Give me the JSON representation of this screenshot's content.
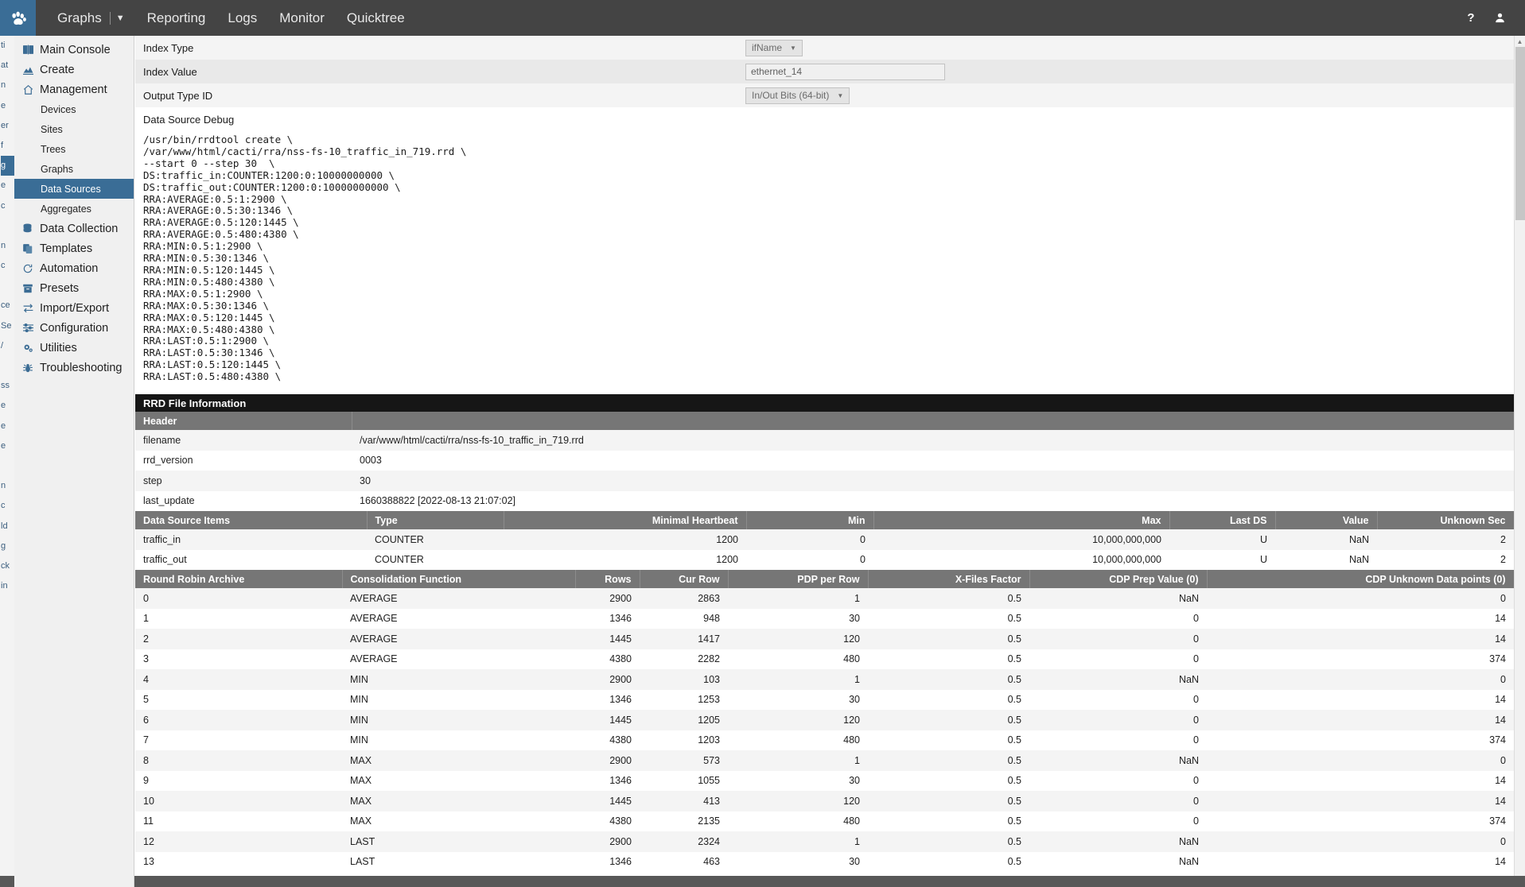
{
  "topbar": {
    "logo_icon": "paw-icon",
    "nav": [
      {
        "label": "Graphs",
        "caret": true
      },
      {
        "label": "Reporting",
        "caret": false
      },
      {
        "label": "Logs",
        "caret": false
      },
      {
        "label": "Monitor",
        "caret": false
      },
      {
        "label": "Quicktree",
        "caret": false
      }
    ],
    "help_icon": "?",
    "user_icon": "user-icon"
  },
  "sidebar": {
    "items": [
      {
        "label": "Main Console",
        "icon": "book-icon",
        "type": "top"
      },
      {
        "label": "Create",
        "icon": "chart-icon",
        "type": "top"
      },
      {
        "label": "Management",
        "icon": "home-icon",
        "type": "top"
      },
      {
        "label": "Devices",
        "icon": "",
        "type": "sub"
      },
      {
        "label": "Sites",
        "icon": "",
        "type": "sub"
      },
      {
        "label": "Trees",
        "icon": "",
        "type": "sub"
      },
      {
        "label": "Graphs",
        "icon": "",
        "type": "sub"
      },
      {
        "label": "Data Sources",
        "icon": "",
        "type": "sub",
        "active": true
      },
      {
        "label": "Aggregates",
        "icon": "",
        "type": "sub"
      },
      {
        "label": "Data Collection",
        "icon": "database-icon",
        "type": "top"
      },
      {
        "label": "Templates",
        "icon": "copy-icon",
        "type": "top"
      },
      {
        "label": "Automation",
        "icon": "refresh-icon",
        "type": "top"
      },
      {
        "label": "Presets",
        "icon": "archive-icon",
        "type": "top"
      },
      {
        "label": "Import/Export",
        "icon": "exchange-icon",
        "type": "top"
      },
      {
        "label": "Configuration",
        "icon": "sliders-icon",
        "type": "top"
      },
      {
        "label": "Utilities",
        "icon": "gears-icon",
        "type": "top"
      },
      {
        "label": "Troubleshooting",
        "icon": "bug-icon",
        "type": "top"
      }
    ]
  },
  "background_menu_sliver": [
    "ti",
    "at",
    "n",
    "e",
    "er",
    "f",
    "g",
    "e",
    "c",
    "",
    "n",
    "c",
    "",
    "ce",
    "Se",
    "/",
    "",
    "ss",
    "e",
    "e",
    "e",
    "",
    "n",
    "c",
    "ld",
    "g",
    "ck",
    "in"
  ],
  "form": {
    "rows": [
      {
        "label": "Index Type",
        "control": "select",
        "value": "ifName"
      },
      {
        "label": "Index Value",
        "control": "input",
        "value": "ethernet_14"
      },
      {
        "label": "Output Type ID",
        "control": "select",
        "value": "In/Out Bits (64-bit)"
      }
    ]
  },
  "debug": {
    "title": "Data Source Debug",
    "command": "/usr/bin/rrdtool create \\\n/var/www/html/cacti/rra/nss-fs-10_traffic_in_719.rrd \\\n--start 0 --step 30  \\\nDS:traffic_in:COUNTER:1200:0:10000000000 \\\nDS:traffic_out:COUNTER:1200:0:10000000000 \\\nRRA:AVERAGE:0.5:1:2900 \\\nRRA:AVERAGE:0.5:30:1346 \\\nRRA:AVERAGE:0.5:120:1445 \\\nRRA:AVERAGE:0.5:480:4380 \\\nRRA:MIN:0.5:1:2900 \\\nRRA:MIN:0.5:30:1346 \\\nRRA:MIN:0.5:120:1445 \\\nRRA:MIN:0.5:480:4380 \\\nRRA:MAX:0.5:1:2900 \\\nRRA:MAX:0.5:30:1346 \\\nRRA:MAX:0.5:120:1445 \\\nRRA:MAX:0.5:480:4380 \\\nRRA:LAST:0.5:1:2900 \\\nRRA:LAST:0.5:30:1346 \\\nRRA:LAST:0.5:120:1445 \\\nRRA:LAST:0.5:480:4380 \\"
  },
  "rrd_section": {
    "title": "RRD File Information",
    "header_col1": "Header",
    "header_col2": "",
    "header_rows": [
      {
        "key": "filename",
        "value": "/var/www/html/cacti/rra/nss-fs-10_traffic_in_719.rrd"
      },
      {
        "key": "rrd_version",
        "value": "0003"
      },
      {
        "key": "step",
        "value": "30"
      },
      {
        "key": "last_update",
        "value": "1660388822 [2022-08-13 21:07:02]"
      }
    ]
  },
  "ds_items": {
    "columns": [
      "Data Source Items",
      "Type",
      "Minimal Heartbeat",
      "Min",
      "Max",
      "Last DS",
      "Value",
      "Unknown Sec"
    ],
    "rows": [
      [
        "traffic_in",
        "COUNTER",
        "1200",
        "0",
        "10,000,000,000",
        "U",
        "NaN",
        "2"
      ],
      [
        "traffic_out",
        "COUNTER",
        "1200",
        "0",
        "10,000,000,000",
        "U",
        "NaN",
        "2"
      ]
    ]
  },
  "rra_table": {
    "columns": [
      "Round Robin Archive",
      "Consolidation Function",
      "Rows",
      "Cur Row",
      "PDP per Row",
      "X-Files Factor",
      "CDP Prep Value (0)",
      "CDP Unknown Data points (0)"
    ],
    "rows": [
      [
        "0",
        "AVERAGE",
        "2900",
        "2863",
        "1",
        "0.5",
        "NaN",
        "0"
      ],
      [
        "1",
        "AVERAGE",
        "1346",
        "948",
        "30",
        "0.5",
        "0",
        "14"
      ],
      [
        "2",
        "AVERAGE",
        "1445",
        "1417",
        "120",
        "0.5",
        "0",
        "14"
      ],
      [
        "3",
        "AVERAGE",
        "4380",
        "2282",
        "480",
        "0.5",
        "0",
        "374"
      ],
      [
        "4",
        "MIN",
        "2900",
        "103",
        "1",
        "0.5",
        "NaN",
        "0"
      ],
      [
        "5",
        "MIN",
        "1346",
        "1253",
        "30",
        "0.5",
        "0",
        "14"
      ],
      [
        "6",
        "MIN",
        "1445",
        "1205",
        "120",
        "0.5",
        "0",
        "14"
      ],
      [
        "7",
        "MIN",
        "4380",
        "1203",
        "480",
        "0.5",
        "0",
        "374"
      ],
      [
        "8",
        "MAX",
        "2900",
        "573",
        "1",
        "0.5",
        "NaN",
        "0"
      ],
      [
        "9",
        "MAX",
        "1346",
        "1055",
        "30",
        "0.5",
        "0",
        "14"
      ],
      [
        "10",
        "MAX",
        "1445",
        "413",
        "120",
        "0.5",
        "0",
        "14"
      ],
      [
        "11",
        "MAX",
        "4380",
        "2135",
        "480",
        "0.5",
        "0",
        "374"
      ],
      [
        "12",
        "LAST",
        "2900",
        "2324",
        "1",
        "0.5",
        "NaN",
        "0"
      ],
      [
        "13",
        "LAST",
        "1346",
        "463",
        "30",
        "0.5",
        "NaN",
        "14"
      ]
    ]
  }
}
